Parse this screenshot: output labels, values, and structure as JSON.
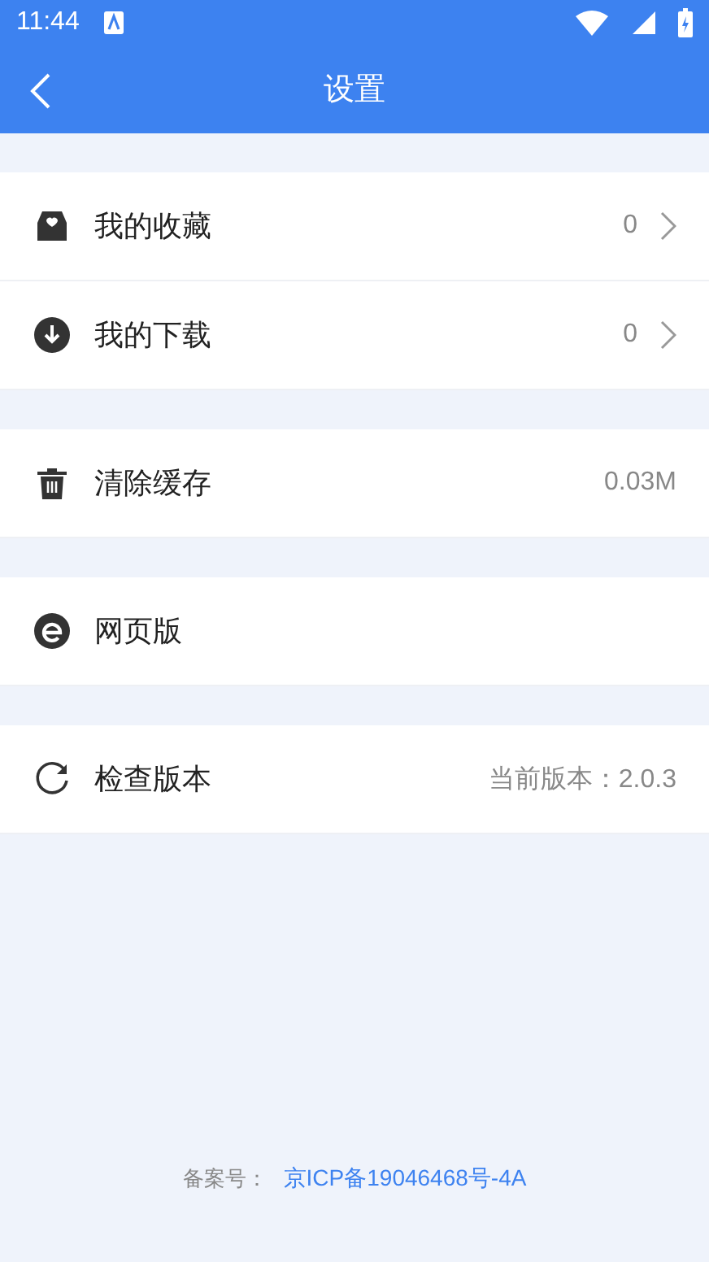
{
  "status_bar": {
    "time": "11:44"
  },
  "header": {
    "title": "设置"
  },
  "groups": [
    {
      "items": [
        {
          "kind": "favorites",
          "label": "我的收藏",
          "value": "0",
          "chevron": true
        },
        {
          "kind": "download",
          "label": "我的下载",
          "value": "0",
          "chevron": true
        }
      ]
    },
    {
      "items": [
        {
          "kind": "trash",
          "label": "清除缓存",
          "value": "0.03M",
          "chevron": false
        }
      ]
    },
    {
      "items": [
        {
          "kind": "browser",
          "label": "网页版",
          "chevron": false
        }
      ]
    },
    {
      "items": [
        {
          "kind": "refresh",
          "label": "检查版本",
          "value": "当前版本：2.0.3",
          "chevron": false
        }
      ]
    }
  ],
  "footer": {
    "label": "备案号：",
    "link": "京ICP备19046468号-4A"
  }
}
